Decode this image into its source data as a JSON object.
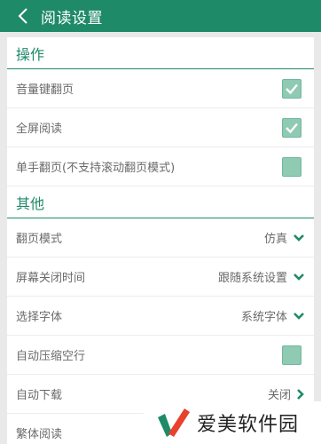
{
  "app_bar": {
    "title": "阅读设置",
    "back_icon": "chevron-left-icon"
  },
  "sections": [
    {
      "title": "操作",
      "rows": [
        {
          "label": "音量键翻页",
          "type": "checkbox",
          "checked": true
        },
        {
          "label": "全屏阅读",
          "type": "checkbox",
          "checked": true
        },
        {
          "label": "单手翻页(不支持滚动翻页模式)",
          "type": "checkbox",
          "checked": false
        }
      ]
    },
    {
      "title": "其他",
      "rows": [
        {
          "label": "翻页模式",
          "type": "select",
          "value": "仿真",
          "icon": "chevron-down-icon"
        },
        {
          "label": "屏幕关闭时间",
          "type": "select",
          "value": "跟随系统设置",
          "icon": "chevron-down-icon"
        },
        {
          "label": "选择字体",
          "type": "select",
          "value": "系统字体",
          "icon": "chevron-down-icon"
        },
        {
          "label": "自动压缩空行",
          "type": "checkbox",
          "checked": false
        },
        {
          "label": "自动下载",
          "type": "link",
          "value": "关闭",
          "icon": "chevron-right-icon"
        },
        {
          "label": "繁体阅读",
          "type": "checkbox",
          "checked": false
        }
      ]
    }
  ],
  "watermark": {
    "text": "爱美软件园"
  },
  "colors": {
    "accent": "#1f8a68",
    "checkbox_fill": "#8fcab3",
    "text_gray": "#6a6a6a",
    "background": "#e9e9e9"
  }
}
